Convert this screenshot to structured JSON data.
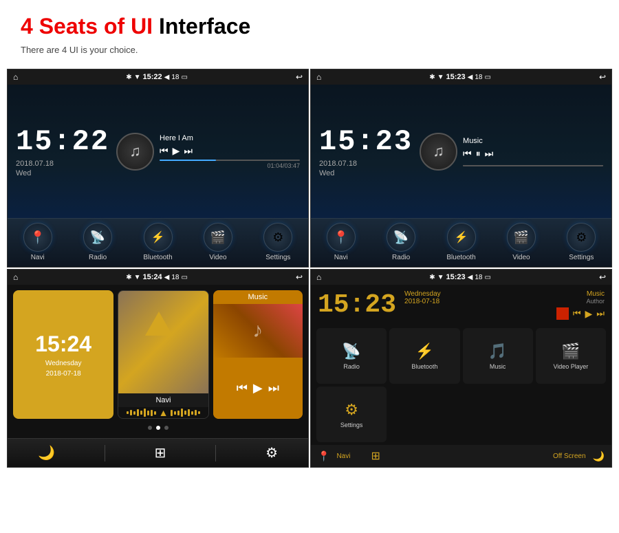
{
  "header": {
    "title_red": "4 Seats of UI",
    "title_black": "Interface",
    "subtitle": "There are 4 UI is your choice."
  },
  "screen1": {
    "status": {
      "time": "15:22",
      "battery": "18"
    },
    "clock": "15:22",
    "date": "2018.07.18",
    "day": "Wed",
    "music": {
      "title": "Here I Am",
      "time": "01:04/03:47"
    },
    "nav": [
      {
        "label": "Navi",
        "icon": "📍"
      },
      {
        "label": "Radio",
        "icon": "📡"
      },
      {
        "label": "Bluetooth",
        "icon": "🔵"
      },
      {
        "label": "Video",
        "icon": "🎬"
      },
      {
        "label": "Settings",
        "icon": "⚙️"
      }
    ]
  },
  "screen2": {
    "status": {
      "time": "15:23",
      "battery": "18"
    },
    "clock": "15:23",
    "date": "2018.07.18",
    "day": "Wed",
    "music": {
      "title": "Music"
    },
    "nav": [
      {
        "label": "Navi",
        "icon": "📍"
      },
      {
        "label": "Radio",
        "icon": "📡"
      },
      {
        "label": "Bluetooth",
        "icon": "🔵"
      },
      {
        "label": "Video",
        "icon": "🎬"
      },
      {
        "label": "Settings",
        "icon": "⚙️"
      }
    ]
  },
  "screen3": {
    "status": {
      "time": "15:24",
      "battery": "18"
    },
    "clock": "15:24",
    "date": "Wednesday",
    "date2": "2018-07-18",
    "cards": {
      "navi": "Navi",
      "music": "Music"
    },
    "toolbar": [
      "🌙",
      "⊞",
      "⚙"
    ]
  },
  "screen4": {
    "status": {
      "time": "15:23",
      "battery": "18"
    },
    "clock": "15:23",
    "date_day": "Wednesday",
    "date": "2018-07-18",
    "music_title": "Music",
    "music_author": "Author",
    "grid_items": [
      {
        "label": "Radio",
        "icon": "📡"
      },
      {
        "label": "Bluetooth",
        "icon": "🔵"
      },
      {
        "label": "Music",
        "icon": "🎵"
      },
      {
        "label": "Video Player",
        "icon": "🎬"
      },
      {
        "label": "Settings",
        "icon": "⚙️"
      },
      {
        "label": "",
        "icon": ""
      },
      {
        "label": "",
        "icon": ""
      },
      {
        "label": "",
        "icon": ""
      }
    ],
    "bottom": {
      "navi": "Navi",
      "off_screen": "Off Screen"
    }
  }
}
